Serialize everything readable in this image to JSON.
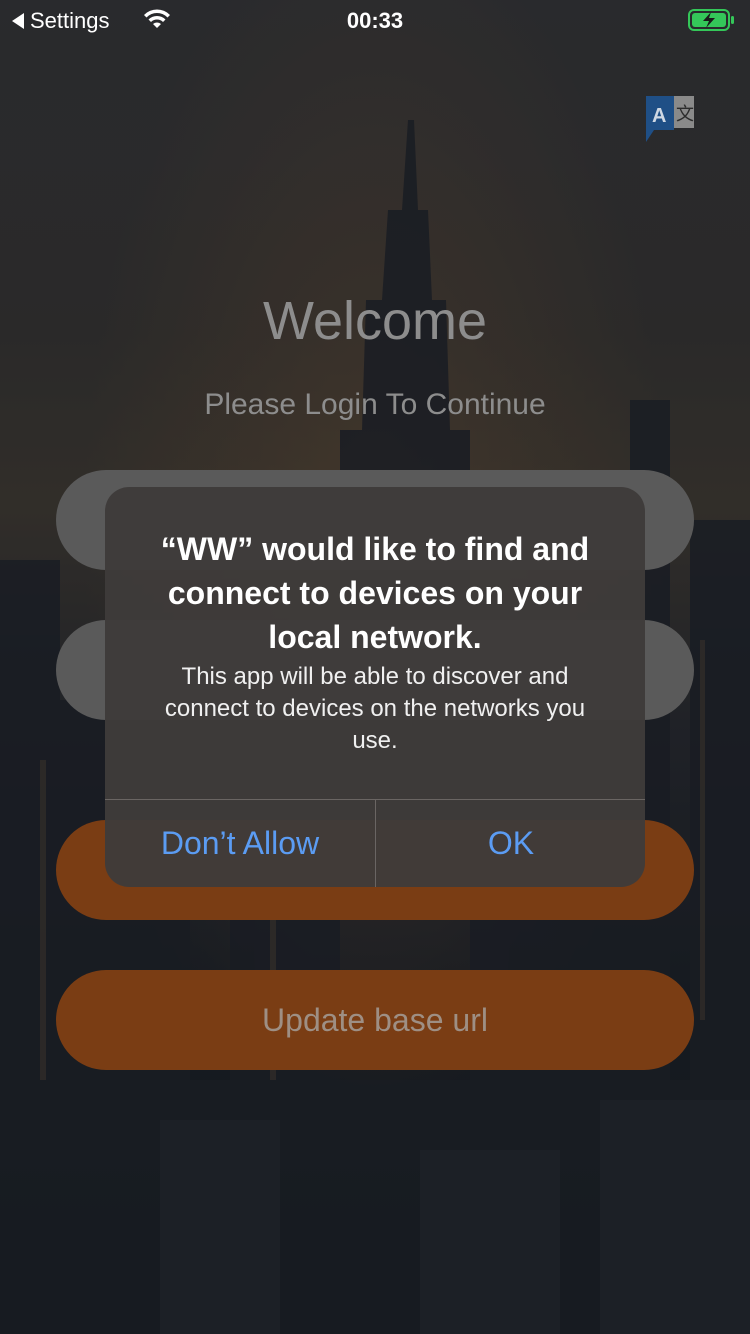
{
  "status_bar": {
    "back_label": "Settings",
    "time": "00:33",
    "battery_color": "#34c759"
  },
  "main": {
    "title": "Welcome",
    "subtitle": "Please Login To Continue",
    "update_button_label": "Update base url"
  },
  "alert": {
    "title": "“WW” would like to find and connect to devices on your local network.",
    "message": "This app will be able to discover and connect to devices on the networks you use.",
    "deny_label": "Don’t Allow",
    "ok_label": "OK"
  },
  "colors": {
    "accent_orange": "#7a3d14",
    "alert_button_text": "#5b9cf3"
  },
  "icons": [
    "wifi-icon",
    "battery-icon",
    "translate-icon",
    "back-arrow-icon"
  ]
}
